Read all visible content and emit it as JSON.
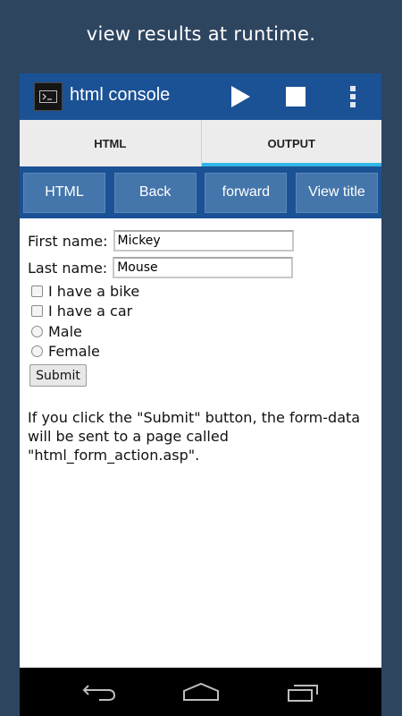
{
  "caption": "view results at runtime.",
  "app": {
    "title": "html console",
    "icons": {
      "app": "terminal-icon",
      "run": "play-icon",
      "stop": "stop-icon",
      "menu": "overflow-menu-icon"
    }
  },
  "tabs": [
    {
      "label": "HTML",
      "active": false
    },
    {
      "label": "OUTPUT",
      "active": true
    }
  ],
  "nav_buttons": [
    "HTML",
    "Back",
    "forward",
    "View title"
  ],
  "form": {
    "first_name_label": "First name:",
    "first_name_value": "Mickey",
    "last_name_label": "Last name:",
    "last_name_value": "Mouse",
    "checkbox_bike": "I have a bike",
    "checkbox_car": "I have a car",
    "radio_male": "Male",
    "radio_female": "Female",
    "submit_label": "Submit"
  },
  "description": "If you click the \"Submit\" button, the form-data will be sent to a page called \"html_form_action.asp\".",
  "colors": {
    "accent": "#33b5e5",
    "bar": "#1b5195",
    "button": "#4576ab",
    "background": "#2e4560"
  },
  "system_nav": {
    "back": "back-icon",
    "home": "home-icon",
    "recents": "recents-icon"
  }
}
